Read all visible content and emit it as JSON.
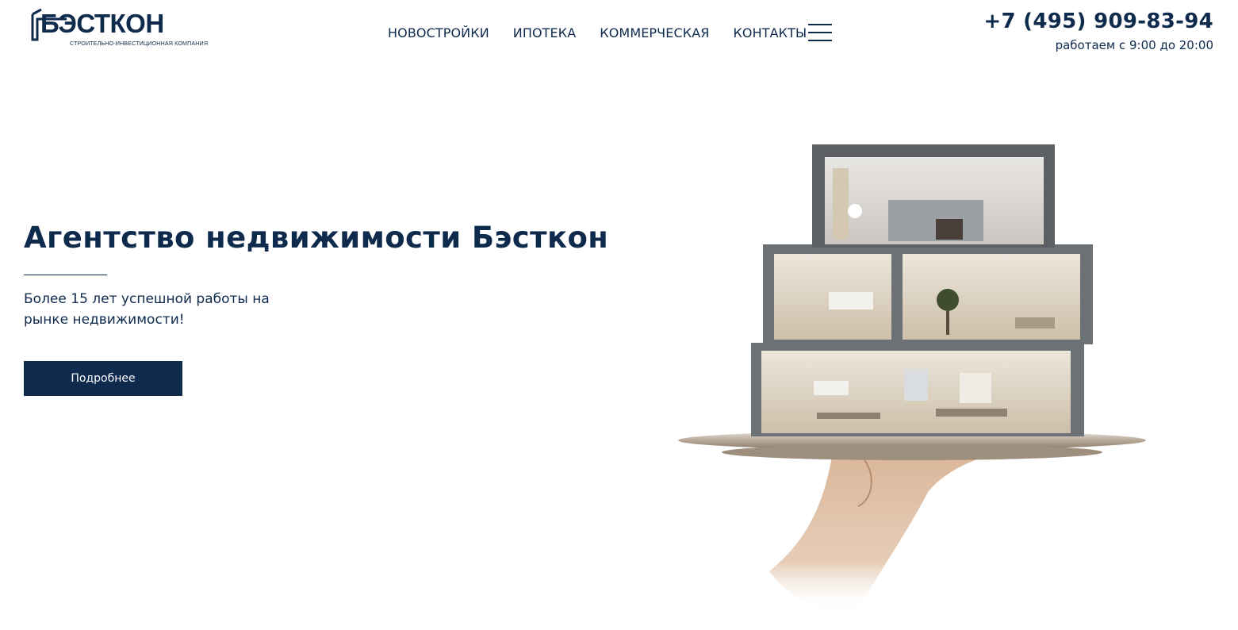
{
  "header": {
    "logo": {
      "name": "БЭСТКОН",
      "tagline": "СТРОИТЕЛЬНО-ИНВЕСТИЦИОННАЯ КОМПАНИЯ"
    },
    "nav": [
      {
        "label": "НОВОСТРОЙКИ"
      },
      {
        "label": "ИПОТЕКА"
      },
      {
        "label": "КОММЕРЧЕСКАЯ"
      },
      {
        "label": "КОНТАКТЫ"
      }
    ],
    "menu_icon": "hamburger-menu-icon",
    "phone": "+7 (495) 909-83-94",
    "hours": "работаем с 9:00 до 20:00"
  },
  "hero": {
    "title": "Агентство недвижимости Бэсткон",
    "subtitle": "Более 15 лет успешной работы на рынке недвижимости!",
    "button_label": "Подробнее",
    "image": "house-on-tray-illustration"
  },
  "colors": {
    "brand": "#0e2a4d",
    "background": "#ffffff",
    "button_text": "#ffffff"
  }
}
